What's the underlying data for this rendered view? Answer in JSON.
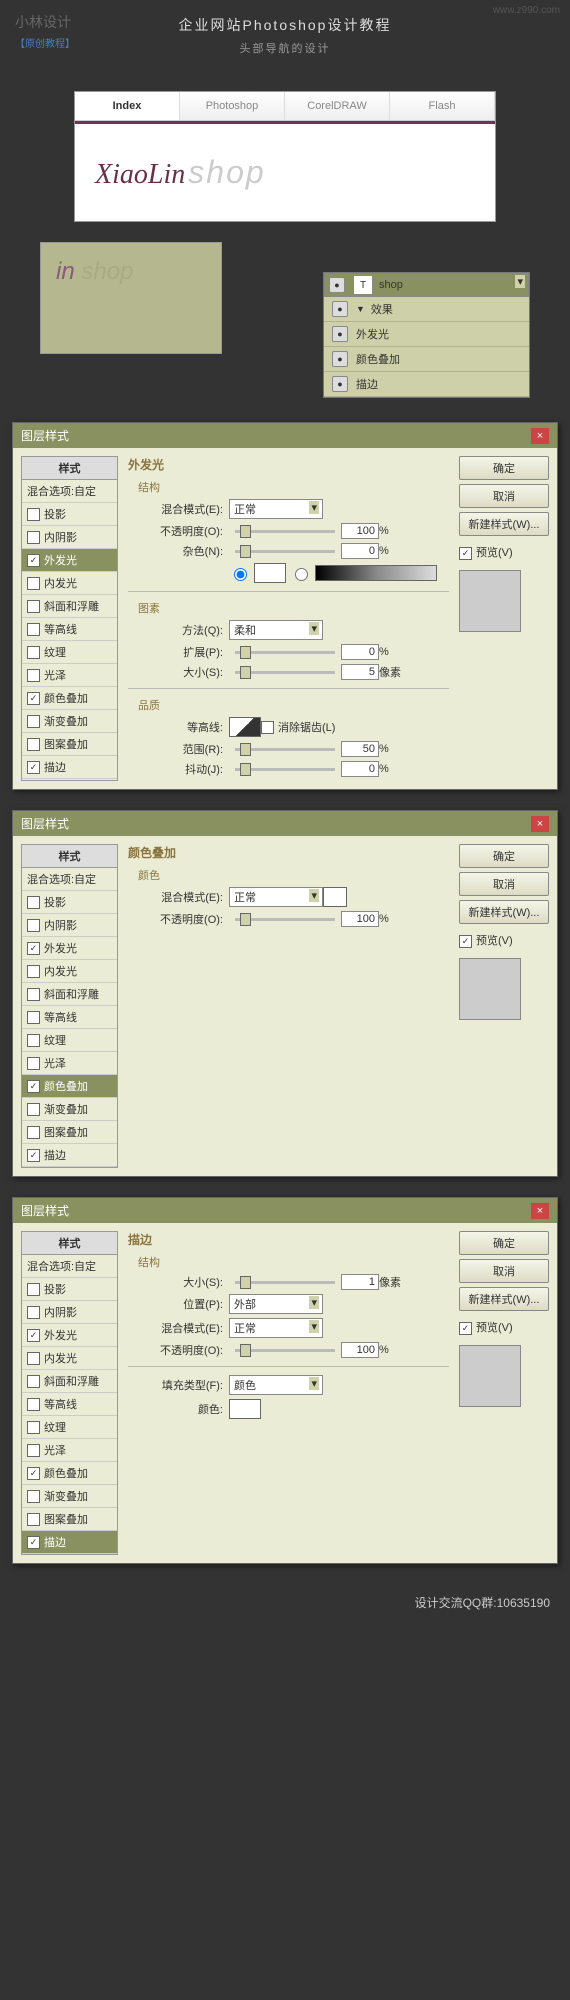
{
  "header": {
    "logo": "小林",
    "logoSuffix": "设计",
    "tagline": "【原创教程】",
    "url": "www.z990.com",
    "title": "企业网站Photoshop设计教程",
    "subtitle": "头部导航的设计"
  },
  "nav": [
    "Index",
    "Photoshop",
    "CorelDRAW",
    "Flash"
  ],
  "brand": {
    "a": "XiaoLin",
    "b": "shop"
  },
  "zoom": {
    "a": "in",
    "b": "shop"
  },
  "layers": {
    "name": "shop",
    "items": [
      "效果",
      "外发光",
      "颜色叠加",
      "描边"
    ]
  },
  "dlgTitle": "图层样式",
  "styleList": {
    "head": "样式",
    "blend": "混合选项:自定",
    "items": [
      "投影",
      "内阴影",
      "外发光",
      "内发光",
      "斜面和浮雕",
      "等高线",
      "纹理",
      "光泽",
      "颜色叠加",
      "渐变叠加",
      "图案叠加",
      "描边"
    ]
  },
  "btns": {
    "ok": "确定",
    "cancel": "取消",
    "new": "新建样式(W)...",
    "preview": "预览(V)"
  },
  "d1": {
    "title": "外发光",
    "s1": "结构",
    "blend": "混合模式(E):",
    "blendV": "正常",
    "opacity": "不透明度(O):",
    "opacityV": "100",
    "pct": "%",
    "noise": "杂色(N):",
    "noiseV": "0",
    "s2": "图素",
    "method": "方法(Q):",
    "methodV": "柔和",
    "spread": "扩展(P):",
    "spreadV": "0",
    "size": "大小(S):",
    "sizeV": "5",
    "px": "像素",
    "s3": "品质",
    "contour": "等高线:",
    "anti": "消除锯齿(L)",
    "range": "范围(R):",
    "rangeV": "50",
    "jitter": "抖动(J):",
    "jitterV": "0"
  },
  "d2": {
    "title": "颜色叠加",
    "s1": "颜色",
    "blend": "混合模式(E):",
    "blendV": "正常",
    "opacity": "不透明度(O):",
    "opacityV": "100",
    "pct": "%"
  },
  "d3": {
    "title": "描边",
    "s1": "结构",
    "size": "大小(S):",
    "sizeV": "1",
    "px": "像素",
    "pos": "位置(P):",
    "posV": "外部",
    "blend": "混合模式(E):",
    "blendV": "正常",
    "opacity": "不透明度(O):",
    "opacityV": "100",
    "pct": "%",
    "fillType": "填充类型(F):",
    "fillTypeV": "颜色",
    "color": "颜色:"
  },
  "footer": "设计交流QQ群:10635190"
}
